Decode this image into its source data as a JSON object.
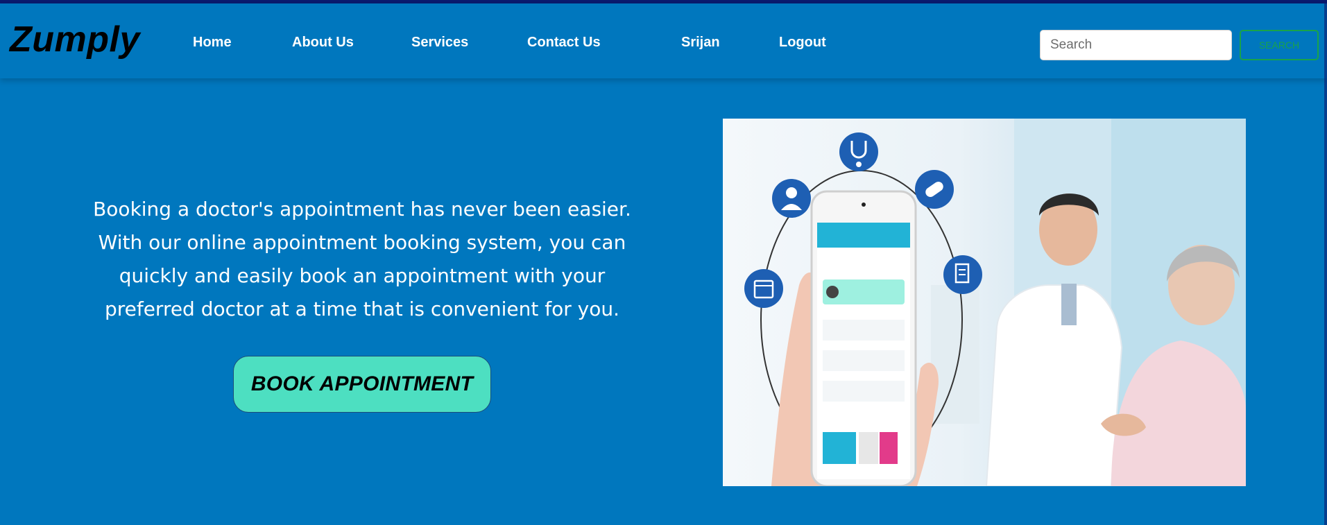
{
  "brand": {
    "name": "Zumply"
  },
  "nav": {
    "home": "Home",
    "about": "About Us",
    "services": "Services",
    "contact": "Contact Us",
    "user": "Srijan",
    "logout": "Logout"
  },
  "search": {
    "placeholder": "Search",
    "button_label": "SEARCH"
  },
  "hero": {
    "line1": "Booking a doctor's appointment has never been easier.",
    "line2": "With our online appointment booking system, you can",
    "line3": "quickly and easily book an appointment with your",
    "line4": "preferred doctor at a time that is convenient for you.",
    "cta": "BOOK APPOINTMENT"
  },
  "colors": {
    "background": "#0077be",
    "top_line": "#0a1a6e",
    "cta_bg": "#4ddfc1",
    "search_border": "#19a34a",
    "icon_circle": "#1e5fb3"
  },
  "image_icons": [
    "stethoscope-icon",
    "pills-icon",
    "doctor-icon",
    "calendar-icon",
    "prescription-icon"
  ]
}
